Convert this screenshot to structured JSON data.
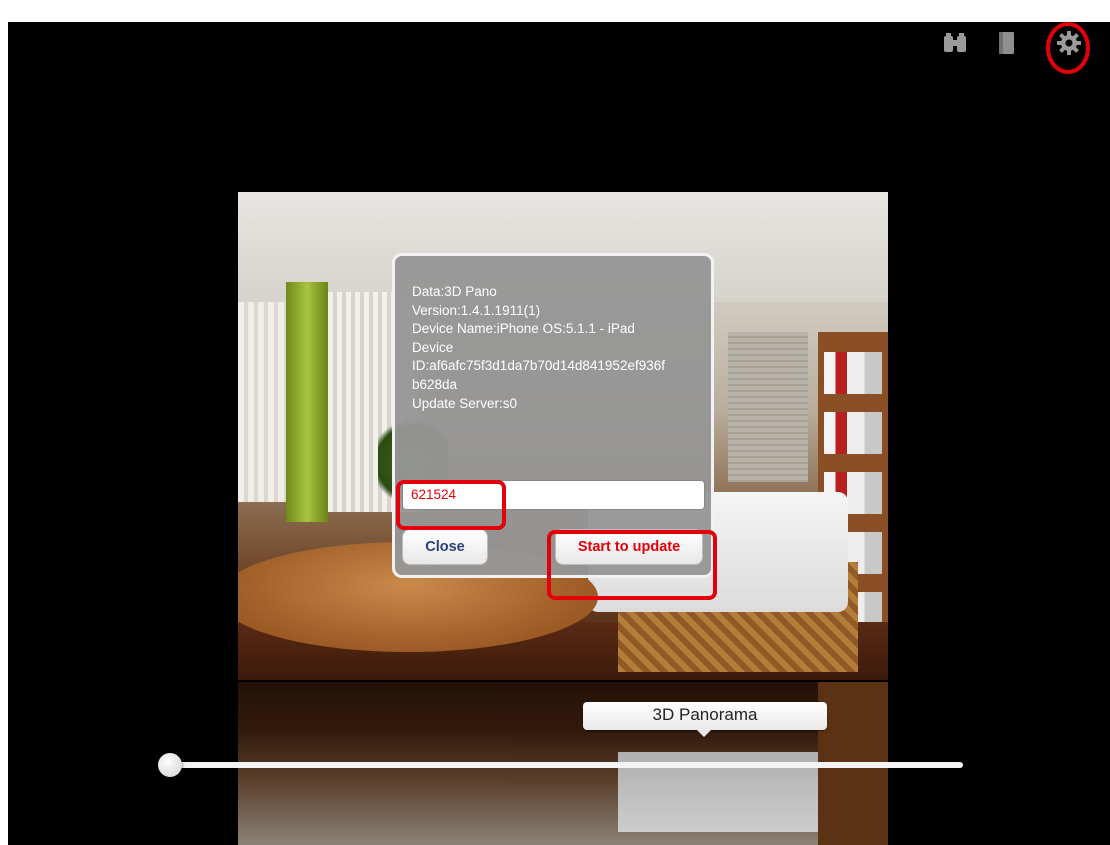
{
  "toolbar": {
    "icons": [
      "binoculars-icon",
      "book-icon",
      "gear-icon"
    ]
  },
  "dialog": {
    "lines": [
      "Data:3D Pano",
      "Version:1.4.1.1911(1)",
      "Device Name:iPhone OS:5.1.1 - iPad",
      "Device",
      "ID:af6afc75f3d1da7b70d14d841952ef936f",
      "b628da",
      "Update Server:s0"
    ],
    "code_value": "621524",
    "close_label": "Close",
    "update_label": "Start to update"
  },
  "panorama": {
    "label": "3D Panorama"
  },
  "slider": {
    "value": 0
  },
  "colors": {
    "highlight": "#e4000b",
    "background": "#000000",
    "dialog": "#969696"
  }
}
